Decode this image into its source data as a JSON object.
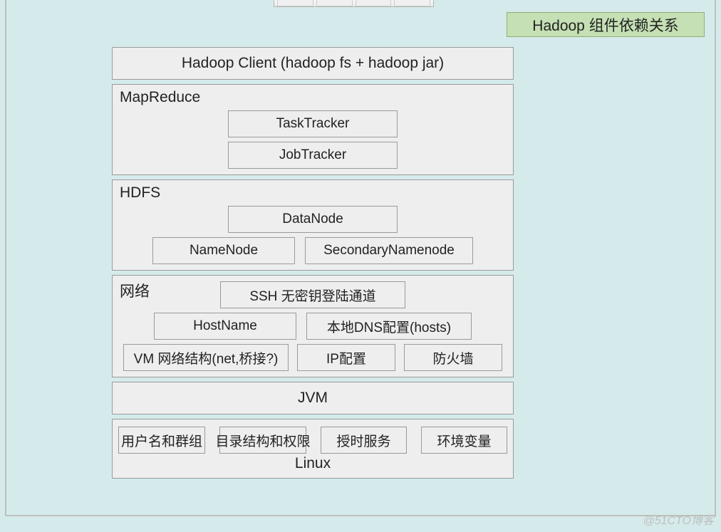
{
  "title_badge": "Hadoop 组件依赖关系",
  "client": {
    "label": "Hadoop Client (hadoop fs + hadoop jar)"
  },
  "mapreduce": {
    "label": "MapReduce",
    "task_tracker": "TaskTracker",
    "job_tracker": "JobTracker"
  },
  "hdfs": {
    "label": "HDFS",
    "data_node": "DataNode",
    "name_node": "NameNode",
    "secondary_namenode": "SecondaryNamenode"
  },
  "network": {
    "label": "网络",
    "ssh_tunnel": "SSH 无密钥登陆通道",
    "hostname": "HostName",
    "local_dns": "本地DNS配置(hosts)",
    "vm_net": "VM 网络结构(net,桥接?)",
    "ip_config": "IP配置",
    "firewall": "防火墙"
  },
  "jvm": {
    "label": "JVM"
  },
  "linux": {
    "user_group": "用户名和群组",
    "dir_perm": "目录结构和权限",
    "ntp": "授时服务",
    "env": "环境变量",
    "label": "Linux"
  },
  "watermark": "@51CTO博客"
}
